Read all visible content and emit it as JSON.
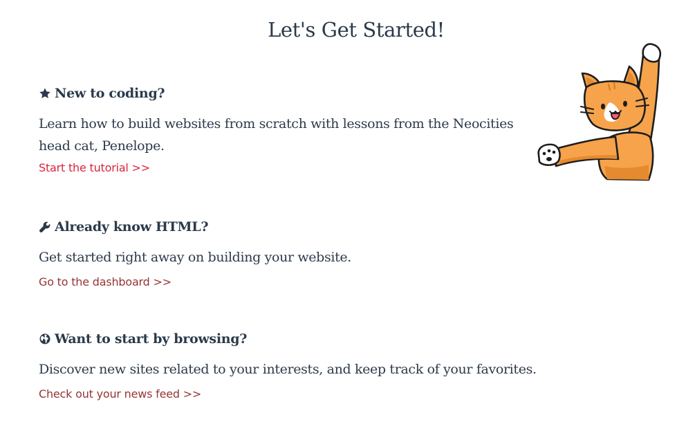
{
  "page": {
    "title": "Let's Get Started!"
  },
  "sections": [
    {
      "icon": "star-icon",
      "heading": "New to coding?",
      "description": "Learn how to build websites from scratch with lessons from the Neocities head cat, Penelope.",
      "link": "Start the tutorial >>",
      "link_color": "#d8253b"
    },
    {
      "icon": "wrench-icon",
      "heading": "Already know HTML?",
      "description": "Get started right away on building your website.",
      "link": "Go to the dashboard >>",
      "link_color": "#963436"
    },
    {
      "icon": "globe-icon",
      "heading": "Want to start by browsing?",
      "description": "Discover new sites related to your interests, and keep track of your favorites.",
      "link": "Check out your news feed >>",
      "link_color": "#963436"
    }
  ],
  "mascot": {
    "icon": "waving-cat-illustration"
  },
  "colors": {
    "text": "#2b3a4a",
    "cat_orange": "#f6a34b",
    "background": "#ffffff"
  }
}
